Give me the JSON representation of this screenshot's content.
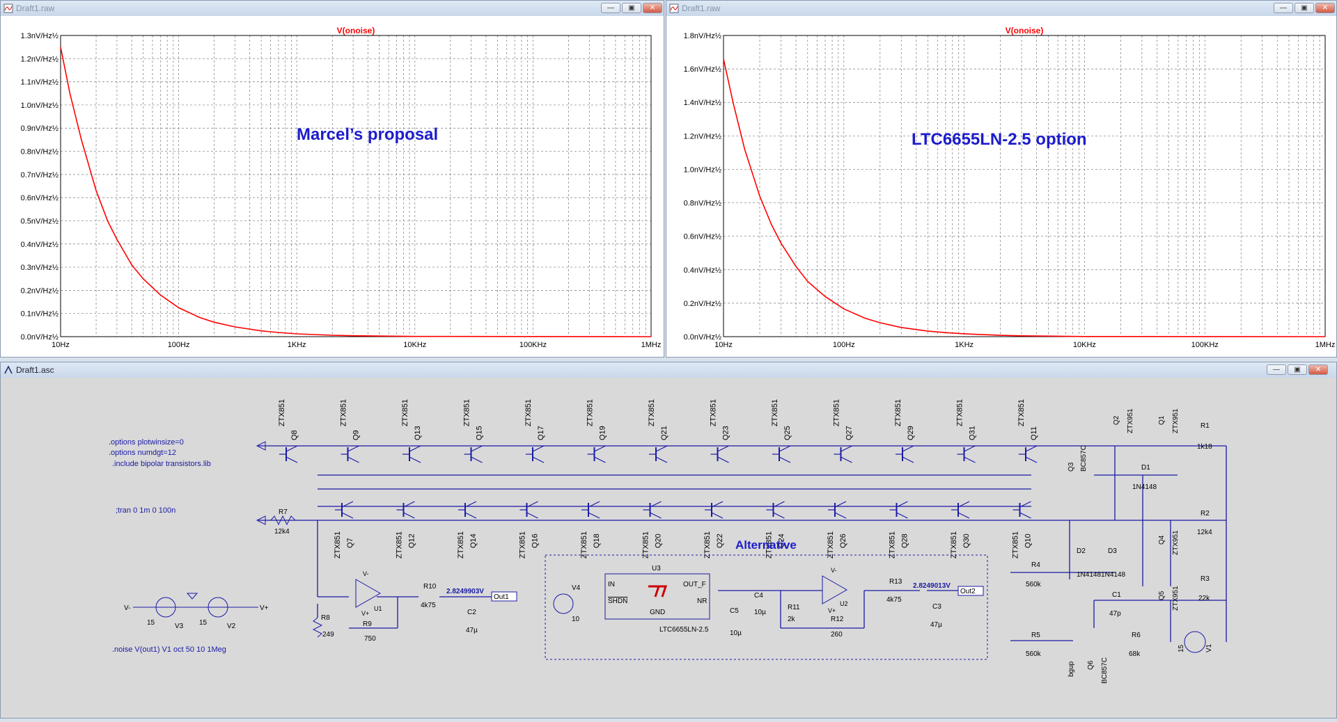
{
  "windows": {
    "plot1": {
      "title": "Draft1.raw",
      "trace_label": "V(onoise)",
      "annotation": "Marcel’s proposal"
    },
    "plot2": {
      "title": "Draft1.raw",
      "trace_label": "V(onoise)",
      "annotation": "LTC6655LN-2.5 option"
    },
    "schematic": {
      "title": "Draft1.asc"
    }
  },
  "colors": {
    "trace": "#ff0000",
    "annotation": "#1c1ccc",
    "wire": "#1a1aa6",
    "grid": "#7a7a7a"
  },
  "chart_data": [
    {
      "type": "line",
      "title": "V(onoise)",
      "x_scale": "log",
      "xlim": [
        10,
        1000000
      ],
      "x_ticks": [
        10,
        100,
        1000,
        10000,
        100000,
        1000000
      ],
      "x_tick_labels": [
        "10Hz",
        "100Hz",
        "1KHz",
        "10KHz",
        "100KHz",
        "1MHz"
      ],
      "ylim": [
        0,
        1.3
      ],
      "y_ticks": [
        0,
        0.1,
        0.2,
        0.3,
        0.4,
        0.5,
        0.6,
        0.7,
        0.8,
        0.9,
        1.0,
        1.1,
        1.2,
        1.3
      ],
      "y_tick_labels": [
        "0.0nV/Hz½",
        "0.1nV/Hz½",
        "0.2nV/Hz½",
        "0.3nV/Hz½",
        "0.4nV/Hz½",
        "0.5nV/Hz½",
        "0.6nV/Hz½",
        "0.7nV/Hz½",
        "0.8nV/Hz½",
        "0.9nV/Hz½",
        "1.0nV/Hz½",
        "1.1nV/Hz½",
        "1.2nV/Hz½",
        "1.3nV/Hz½"
      ],
      "grid": true,
      "series": [
        {
          "name": "V(onoise)",
          "x": [
            10,
            12,
            15,
            20,
            25,
            30,
            40,
            50,
            70,
            100,
            150,
            200,
            300,
            500,
            700,
            1000,
            2000,
            3000,
            10000,
            1000000
          ],
          "y": [
            1.25,
            1.05,
            0.85,
            0.63,
            0.5,
            0.42,
            0.31,
            0.25,
            0.18,
            0.125,
            0.083,
            0.062,
            0.042,
            0.025,
            0.018,
            0.012,
            0.006,
            0.004,
            0.001,
            0
          ]
        }
      ]
    },
    {
      "type": "line",
      "title": "V(onoise)",
      "x_scale": "log",
      "xlim": [
        10,
        1000000
      ],
      "x_ticks": [
        10,
        100,
        1000,
        10000,
        100000,
        1000000
      ],
      "x_tick_labels": [
        "10Hz",
        "100Hz",
        "1KHz",
        "10KHz",
        "100KHz",
        "1MHz"
      ],
      "ylim": [
        0,
        1.8
      ],
      "y_ticks": [
        0,
        0.2,
        0.4,
        0.6,
        0.8,
        1.0,
        1.2,
        1.4,
        1.6,
        1.8
      ],
      "y_tick_labels": [
        "0.0nV/Hz½",
        "0.2nV/Hz½",
        "0.4nV/Hz½",
        "0.6nV/Hz½",
        "0.8nV/Hz½",
        "1.0nV/Hz½",
        "1.2nV/Hz½",
        "1.4nV/Hz½",
        "1.6nV/Hz½",
        "1.8nV/Hz½"
      ],
      "grid": true,
      "series": [
        {
          "name": "V(onoise)",
          "x": [
            10,
            12,
            15,
            20,
            25,
            30,
            40,
            50,
            70,
            100,
            150,
            200,
            300,
            500,
            700,
            1000,
            2000,
            3000,
            10000,
            1000000
          ],
          "y": [
            1.66,
            1.4,
            1.12,
            0.84,
            0.67,
            0.56,
            0.42,
            0.33,
            0.24,
            0.166,
            0.11,
            0.083,
            0.055,
            0.033,
            0.024,
            0.017,
            0.008,
            0.005,
            0.001,
            0
          ]
        }
      ]
    }
  ],
  "schematic": {
    "directives": [
      ".options plotwinsize=0",
      ".options numdgt=12",
      ".include bipolar transistors.lib"
    ],
    "tran": ";tran 0 1m 0 100n",
    "noise": ".noise V(out1) V1 oct 50 10 1Meg",
    "alternative": "Alternative",
    "top_transistors": [
      {
        "type": "ZTX851",
        "ref": "Q8"
      },
      {
        "type": "ZTX851",
        "ref": "Q9"
      },
      {
        "type": "ZTX851",
        "ref": "Q13"
      },
      {
        "type": "ZTX851",
        "ref": "Q15"
      },
      {
        "type": "ZTX851",
        "ref": "Q17"
      },
      {
        "type": "ZTX851",
        "ref": "Q19"
      },
      {
        "type": "ZTX851",
        "ref": "Q21"
      },
      {
        "type": "ZTX851",
        "ref": "Q23"
      },
      {
        "type": "ZTX851",
        "ref": "Q25"
      },
      {
        "type": "ZTX851",
        "ref": "Q27"
      },
      {
        "type": "ZTX851",
        "ref": "Q29"
      },
      {
        "type": "ZTX851",
        "ref": "Q31"
      },
      {
        "type": "ZTX851",
        "ref": "Q11"
      }
    ],
    "bottom_transistors": [
      {
        "type": "ZTX851",
        "ref": "Q7"
      },
      {
        "type": "ZTX851",
        "ref": "Q12"
      },
      {
        "type": "ZTX851",
        "ref": "Q14"
      },
      {
        "type": "ZTX851",
        "ref": "Q16"
      },
      {
        "type": "ZTX851",
        "ref": "Q18"
      },
      {
        "type": "ZTX851",
        "ref": "Q20"
      },
      {
        "type": "ZTX851",
        "ref": "Q22"
      },
      {
        "type": "ZTX851",
        "ref": "Q24"
      },
      {
        "type": "ZTX851",
        "ref": "Q26"
      },
      {
        "type": "ZTX851",
        "ref": "Q28"
      },
      {
        "type": "ZTX851",
        "ref": "Q30"
      },
      {
        "type": "ZTX851",
        "ref": "Q10"
      }
    ],
    "labels": {
      "r7": "R7",
      "r7v": "12k4",
      "v_minus": "V-",
      "v_plus": "V+",
      "v3": "V3",
      "v2": "V2",
      "v3v": "15",
      "v2v": "15",
      "r8": "R8",
      "r8v": "249",
      "r9": "R9",
      "r9v": "750",
      "u1": "U1",
      "r10": "R10",
      "r10v": "4k75",
      "out1v": "2.8249903V",
      "out1": "Out1",
      "c2": "C2",
      "c2v": "47µ",
      "opamp_vm": "V-",
      "opamp_vp": "V+",
      "v4": "V4",
      "v4v": "10",
      "u3": "U3",
      "in": "IN",
      "shdn": "SHDN",
      "gnd": "GND",
      "outf": "OUT_F",
      "nr": "NR",
      "u3part": "LTC6655LN-2.5",
      "c5": "C5",
      "c5v": "10µ",
      "c4": "C4",
      "c4v": "10µ",
      "r11": "R11",
      "r11v": "2k",
      "r12": "R12",
      "r12v": "260",
      "u2": "U2",
      "r13": "R13",
      "r13v": "4k75",
      "out2v": "2.8249013V",
      "out2": "Out2",
      "c3": "C3",
      "c3v": "47µ",
      "q2": "Q2",
      "q2t": "ZTX951",
      "q1": "Q1",
      "q1t": "ZTX951",
      "r1": "R1",
      "r1v": "1k18",
      "q3": "Q3",
      "q3t": "BC857C",
      "d1": "D1",
      "d1t": "1N4148",
      "r2": "R2",
      "r2v": "12k4",
      "q4": "Q4",
      "q4t": "ZTX951",
      "d2": "D2",
      "d3": "D3",
      "d23t": "1N41481N4148",
      "r4": "R4",
      "r4v": "560k",
      "r3": "R3",
      "r3v": "22k",
      "q5": "Q5",
      "q5t": "ZTX951",
      "c1": "C1",
      "c1v": "47p",
      "r5": "R5",
      "r5v": "560k",
      "r6": "R6",
      "r6v": "68k",
      "q6": "Q6",
      "q6t": "BC857C",
      "bgup": "bgup",
      "v1": "V1",
      "v1v": "15"
    }
  }
}
